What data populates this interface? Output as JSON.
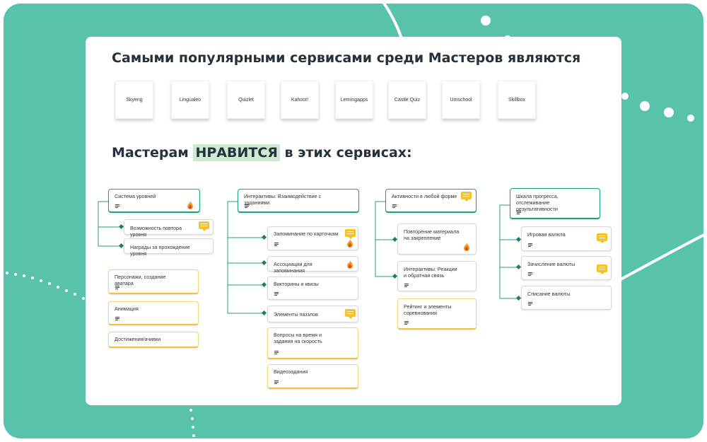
{
  "headings": {
    "popular": "Самыми популярными сервисами среди Мастеров являются",
    "likes_before": "Мастерам ",
    "likes_highlight": "НРАВИТСЯ",
    "likes_after": " в этих сервисах:"
  },
  "services": [
    "Skyeng",
    "Lingualeo",
    "Quizlet",
    "Kahoot!",
    "Lerningapps",
    "Castle Quiz",
    "Umschool",
    "Skillbox"
  ],
  "nodes": {
    "c1_root": "Система уровней",
    "c1_a": "Возможность повтора уровня",
    "c1_b": "Награды за прохождение уровня",
    "c1_y1": "Персонажи, создание аватара",
    "c1_y2": "Анимация",
    "c1_y3": "Достижения/ачивки",
    "c2_root": "Интерактивы: Взаимодействие с заданиями",
    "c2_a": "Запоминание по карточкам",
    "c2_b": "Ассоциации для запоминания",
    "c2_c": "Викторины и квизы",
    "c2_d": "Элементы паззлов",
    "c2_y1": "Вопросы на время и задания на скорость",
    "c2_y2": "Видеозадания",
    "c3_root": "Активности в любой форме",
    "c3_a": "Повторение материала на закрепление",
    "c3_b": "Интерактивы: Реакции и обратная связь",
    "c3_y1": "Рейтинг и элементы соревнования",
    "c4_root": "Шкала прогресса, отслеживание результативности",
    "c4_a": "Игровая валюта",
    "c4_b": "Зачисление валюты",
    "c4_c": "Списание валюты"
  },
  "colors": {
    "frame": "#59c2aa",
    "root_border": "#19a37f",
    "highlight": "#cdebd1",
    "comment_icon": "#f5c22b",
    "yellow_border": "#f0c040"
  },
  "icons": {
    "comment": "comment-icon",
    "fire": "fire-icon",
    "note": "note-icon"
  }
}
